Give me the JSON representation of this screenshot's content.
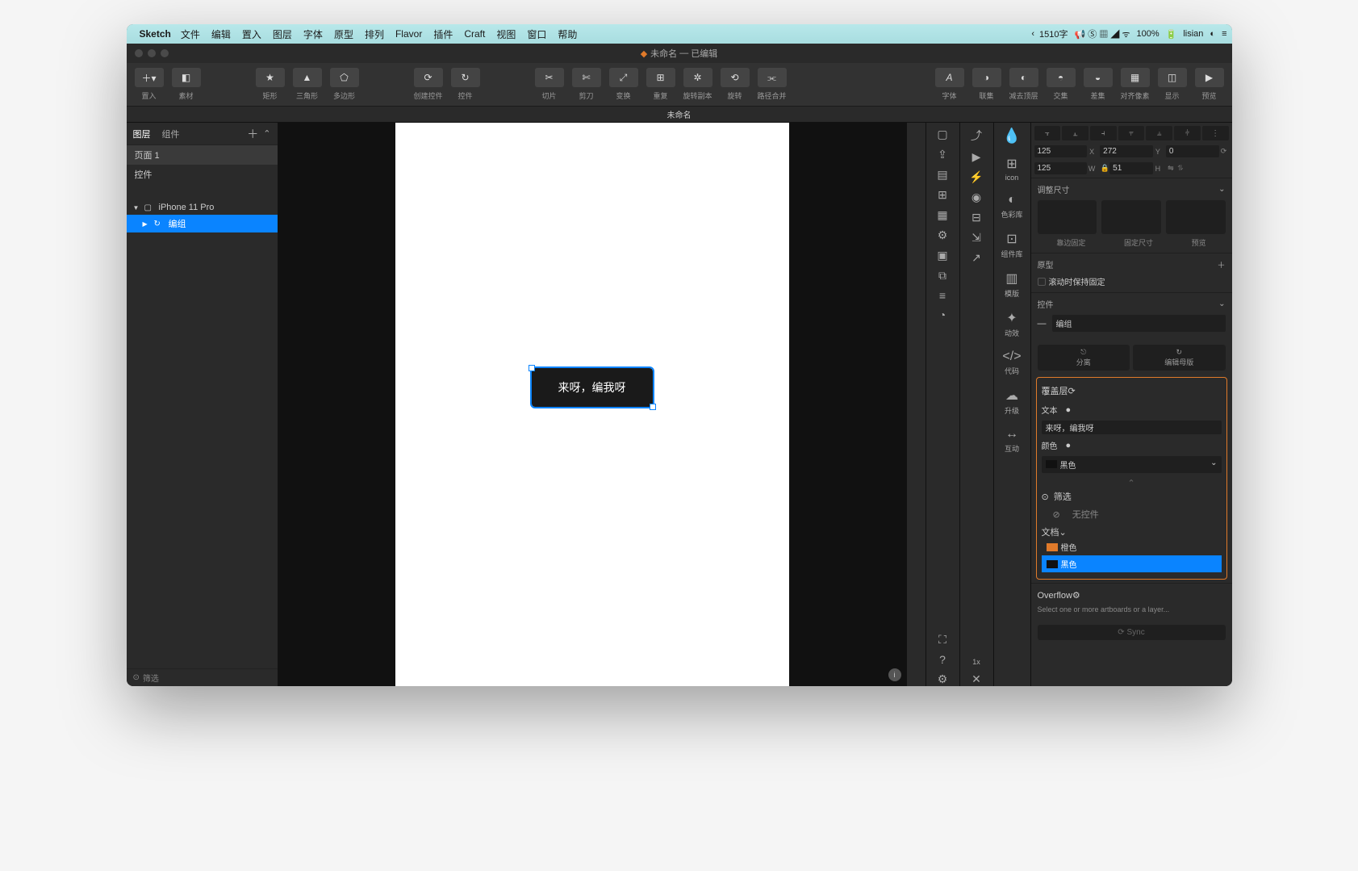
{
  "menubar": {
    "app": "Sketch",
    "items": [
      "文件",
      "编辑",
      "置入",
      "图层",
      "字体",
      "原型",
      "排列",
      "Flavor",
      "插件",
      "Craft",
      "视图",
      "窗口",
      "帮助"
    ],
    "status_left": "1510字",
    "battery": "100%",
    "user": "lisian"
  },
  "titlebar": {
    "file": "未命名",
    "state": "已编辑"
  },
  "toolbar": {
    "insert": "置入",
    "material": "素材",
    "rect": "矩形",
    "tri": "三角形",
    "poly": "多边形",
    "create_ctrl": "创建控件",
    "ctrl": "控件",
    "slice": "切片",
    "cut": "剪刀",
    "transform": "变换",
    "rep": "重复",
    "rot_copy": "旋转副本",
    "rotate": "旋转",
    "path": "路径合并",
    "font": "字体",
    "merge": "联集",
    "minus_top": "减去顶层",
    "intersect": "交集",
    "diff": "差集",
    "align": "对齐像素",
    "show": "显示",
    "preview": "预览"
  },
  "tab": {
    "doc": "未命名"
  },
  "leftpanel": {
    "tab_layers": "图层",
    "tab_components": "组件",
    "page1": "页面 1",
    "controls": "控件",
    "artboard": "iPhone 11 Pro",
    "group": "编组",
    "filter": "筛选"
  },
  "canvas": {
    "widget_text": "来呀，编我呀"
  },
  "sidecol2": {
    "icon": "icon",
    "colorlib": "色彩库",
    "complib": "组件库",
    "template": "模版",
    "effect": "动效",
    "code": "代码",
    "upgrade": "升级",
    "interact": "互动"
  },
  "inspector": {
    "x": "125",
    "xlab": "X",
    "y": "272",
    "ylab": "Y",
    "a0": "0",
    "w": "125",
    "wlab": "W",
    "h": "51",
    "hlab": "H",
    "resize_title": "调整尺寸",
    "pin": "靠边固定",
    "fixsize": "固定尺寸",
    "preview": "预览",
    "proto_title": "原型",
    "fix_scroll": "滚动时保持固定",
    "control_title": "控件",
    "ctrl_name": "编组",
    "detach": "分离",
    "edit_master": "编辑母版",
    "overlay_title": "覆盖层",
    "text_label": "文本",
    "text_value": "来呀，编我呀",
    "color_label": "颜色",
    "color_value": "黑色",
    "filter_label": "筛选",
    "no_ctrl": "无控件",
    "doc_label": "文档",
    "orange": "橙色",
    "black": "黑色",
    "overflow": "Overflow",
    "overflow_hint": "Select one or more artboards or a layer...",
    "sync": "Sync"
  }
}
